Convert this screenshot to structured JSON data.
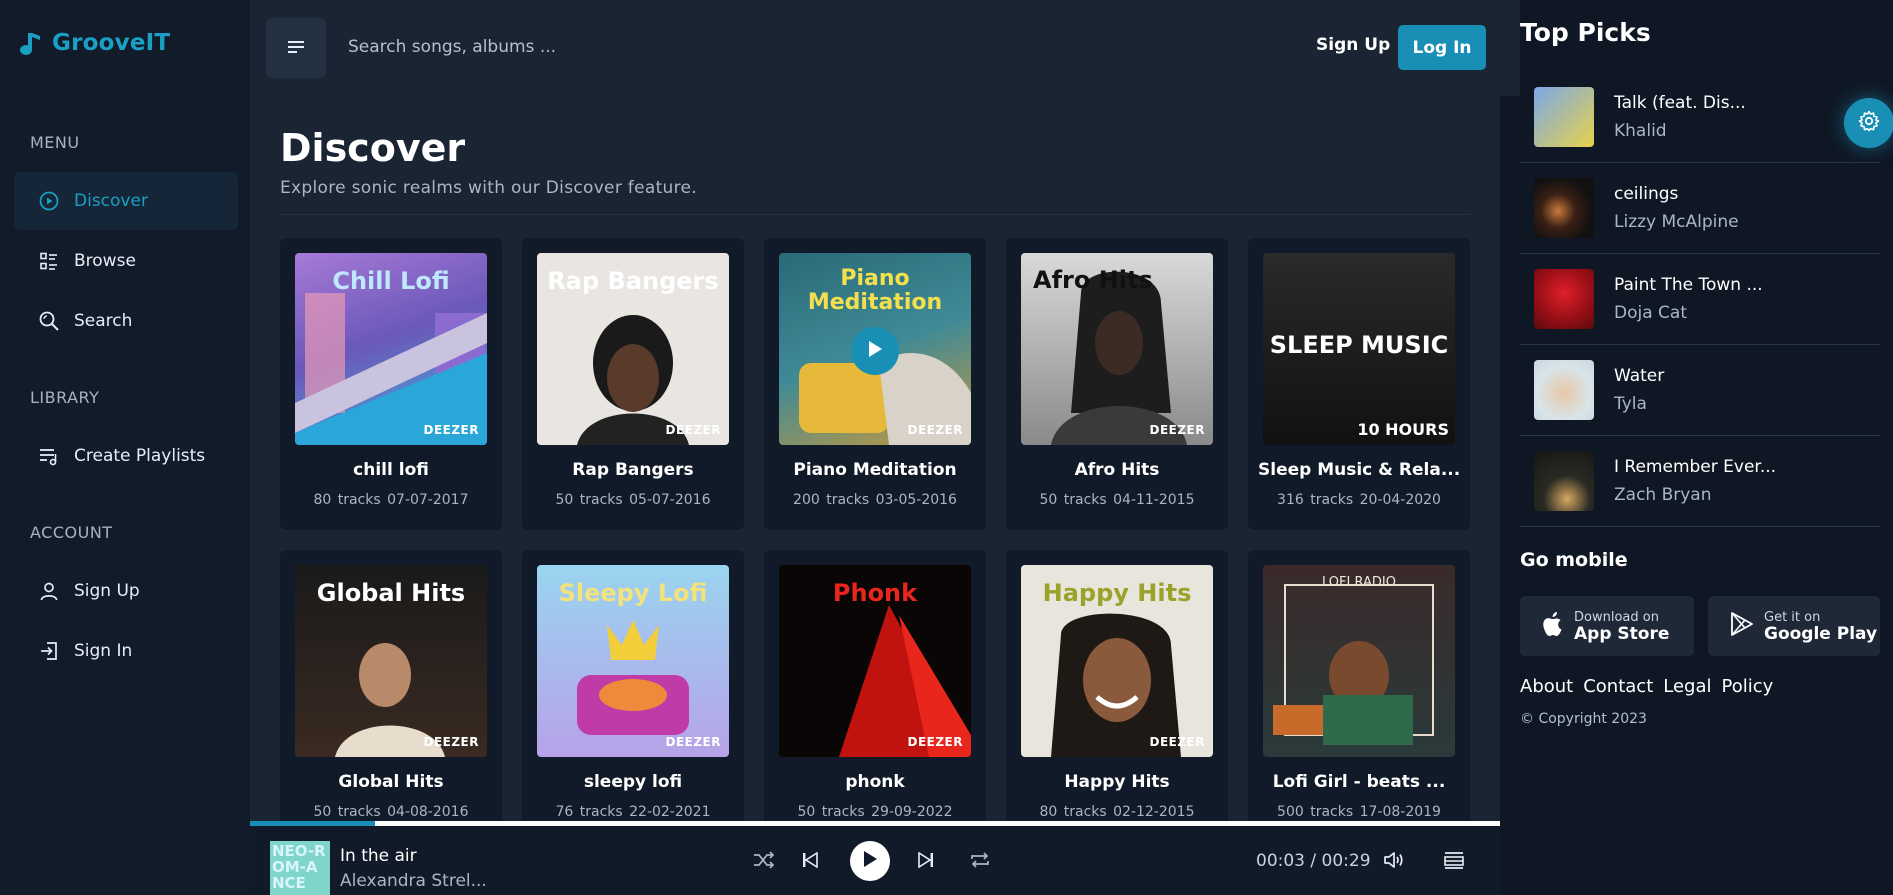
{
  "app": {
    "brand": "GrooveIT"
  },
  "sidebar": {
    "menu_title": "MENU",
    "library_title": "LIBRARY",
    "account_title": "ACCOUNT",
    "items": [
      {
        "label": "Discover",
        "icon": "play-circle-icon"
      },
      {
        "label": "Browse",
        "icon": "list-icon"
      },
      {
        "label": "Search",
        "icon": "search-icon"
      },
      {
        "label": "Create Playlists",
        "icon": "playlist-add-icon"
      },
      {
        "label": "Sign Up",
        "icon": "user-icon"
      },
      {
        "label": "Sign In",
        "icon": "login-icon"
      }
    ]
  },
  "header": {
    "search_placeholder": "Search songs, albums ...",
    "signup": "Sign Up",
    "login": "Log In"
  },
  "main": {
    "title": "Discover",
    "subtitle": "Explore sonic realms with our Discover feature.",
    "cover_brand": "DEEZER",
    "cards": [
      {
        "name": "chill lofi",
        "tracks": "80 tracks",
        "date": "07-07-2017",
        "cover_text": "Chill Lofi"
      },
      {
        "name": "Rap Bangers",
        "tracks": "50 tracks",
        "date": "05-07-2016",
        "cover_text": "Rap Bangers"
      },
      {
        "name": "Piano Meditation",
        "tracks": "200 tracks",
        "date": "03-05-2016",
        "cover_text": "Piano Meditation"
      },
      {
        "name": "Afro Hits",
        "tracks": "50 tracks",
        "date": "04-11-2015",
        "cover_text": "Afro Hits"
      },
      {
        "name": "Sleep Music & Rela...",
        "tracks": "316 tracks",
        "date": "20-04-2020",
        "cover_text": "SLEEP MUSIC",
        "cover_text2": "10 HOURS"
      },
      {
        "name": "Global Hits",
        "tracks": "50 tracks",
        "date": "04-08-2016",
        "cover_text": "Global Hits"
      },
      {
        "name": "sleepy lofi",
        "tracks": "76 tracks",
        "date": "22-02-2021",
        "cover_text": "Sleepy Lofi"
      },
      {
        "name": "phonk",
        "tracks": "50 tracks",
        "date": "29-09-2022",
        "cover_text": "Phonk"
      },
      {
        "name": "Happy Hits",
        "tracks": "80 tracks",
        "date": "02-12-2015",
        "cover_text": "Happy Hits"
      },
      {
        "name": "Lofi Girl - beats ...",
        "tracks": "500 tracks",
        "date": "17-08-2019",
        "cover_text": "LOFI RADIO"
      }
    ]
  },
  "right": {
    "title": "Top Picks",
    "picks": [
      {
        "title": "Talk (feat. Dis...",
        "artist": "Khalid"
      },
      {
        "title": "ceilings",
        "artist": "Lizzy McAlpine"
      },
      {
        "title": "Paint The Town ...",
        "artist": "Doja Cat"
      },
      {
        "title": "Water",
        "artist": "Tyla"
      },
      {
        "title": "I Remember Ever...",
        "artist": "Zach Bryan"
      }
    ],
    "go_mobile": "Go mobile",
    "app_store": {
      "line1": "Download on",
      "line2": "App Store"
    },
    "google_play": {
      "line1": "Get it on",
      "line2": "Google Play"
    },
    "links": [
      "About",
      "Contact",
      "Legal",
      "Policy"
    ],
    "copyright": "© Copyright 2023"
  },
  "player": {
    "title": "In the air",
    "artist": "Alexandra Strel...",
    "current": "00:03",
    "separator": "/",
    "duration": "00:29",
    "progress_fraction": 0.1,
    "thumb_text": "NEO-ROM-ANCE"
  },
  "colors": {
    "accent": "#1a8fb5",
    "brand": "#1aa0c4",
    "background": "#0f1724",
    "panel": "#1a2433"
  }
}
